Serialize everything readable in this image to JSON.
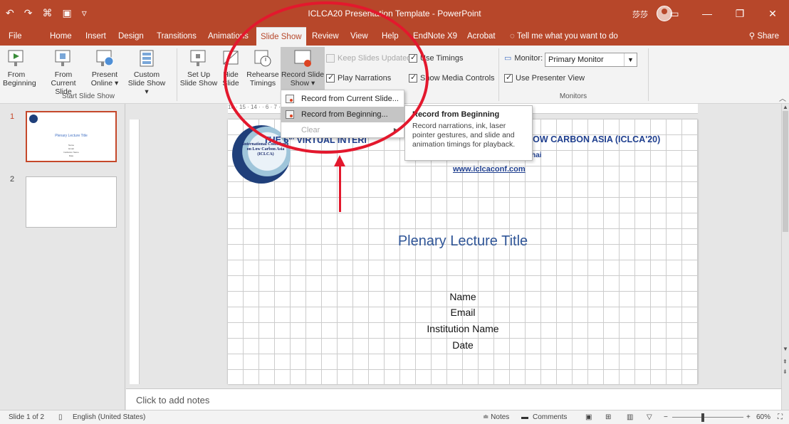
{
  "titlebar": {
    "title": "ICLCA20 Presentation Template  -  PowerPoint",
    "user_initials": "莎莎",
    "qat": [
      "↶",
      "↷",
      "⌘",
      "▣",
      "▿"
    ],
    "win": [
      "▭",
      "—",
      "❐",
      "✕"
    ]
  },
  "tabs": [
    {
      "label": "File"
    },
    {
      "label": "Home"
    },
    {
      "label": "Insert"
    },
    {
      "label": "Design"
    },
    {
      "label": "Transitions"
    },
    {
      "label": "Animations"
    },
    {
      "label": "Slide Show"
    },
    {
      "label": "Review"
    },
    {
      "label": "View"
    },
    {
      "label": "Help"
    },
    {
      "label": "EndNote X9"
    },
    {
      "label": "Acrobat"
    }
  ],
  "tell_me": "Tell me what you want to do",
  "share": "Share",
  "ribbon": {
    "from_beginning": "From Beginning",
    "from_current": "From Current Slide",
    "present_online": "Present Online ▾",
    "custom_show": "Custom Slide Show ▾",
    "group_start": "Start Slide Show",
    "setup_show": "Set Up Slide Show",
    "hide_slide": "Hide Slide",
    "rehearse": "Rehearse Timings",
    "record_show": "Record Slide Show ▾",
    "keep_updated": "Keep Slides Updated",
    "use_timings": "Use Timings",
    "play_narrations": "Play Narrations",
    "show_media": "Show Media Controls",
    "monitor_label": "Monitor:",
    "monitor_value": "Primary Monitor",
    "presenter_view": "Use Presenter View",
    "group_monitors": "Monitors"
  },
  "menu": {
    "items": [
      {
        "label": "Record from Current Slide..."
      },
      {
        "label": "Record from Beginning..."
      },
      {
        "label": "Clear"
      }
    ]
  },
  "tooltip": {
    "title": "Record from Beginning",
    "body": "Record narrations, ink, laser pointer gestures, and slide and animation timings for playback."
  },
  "ruler": "16 · 15 · 14 ·                                                                      · 6 · 7 · 8 · 9 · 10 · 11 · 12 · 13 · 14 · 15 · 16 ·",
  "slides": [
    {
      "num": "1",
      "thumb_title": "Plenary Lecture Title",
      "thumb_lines": [
        "Name",
        "Email",
        "Institution Name",
        "Date"
      ]
    },
    {
      "num": "2"
    }
  ],
  "slide": {
    "logo_text": "International Conference on Low Carbon Asia (ICLCA)",
    "conf_left": "THE 6",
    "conf_sup": "th",
    "conf_left_rest": " VIRTUAL INTERI",
    "conf_right": "N LOW CARBON ASIA (ICLCA'20)",
    "location": "ghai",
    "url": "www.iclcaconf.com",
    "title": "Plenary Lecture Title",
    "name": "Name",
    "email": "Email",
    "institution": "Institution Name",
    "date": "Date"
  },
  "notes": "Click to add notes",
  "status": {
    "slide_count": "Slide 1 of 2",
    "language": "English (United States)",
    "notes": "≐ Notes",
    "comments": "Comments",
    "zoom": "60%"
  }
}
